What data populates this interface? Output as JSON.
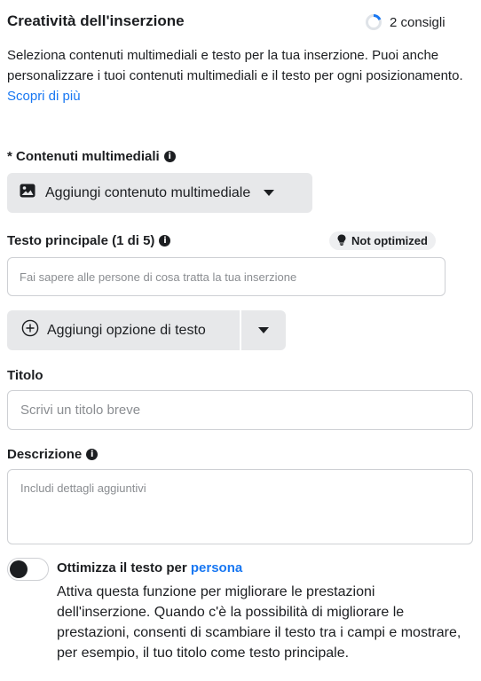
{
  "header": {
    "title": "Creatività dell'inserzione",
    "tips_label": "2 consigli"
  },
  "intro": {
    "text": "Seleziona contenuti multimediali e testo per la tua inserzione. Puoi anche personalizzare i tuoi contenuti multimediali e il testo per ogni posizionamento.",
    "link": "Scopri di più"
  },
  "media": {
    "label": "* Contenuti multimediali",
    "button_label": "Aggiungi contenuto multimediale"
  },
  "primary_text": {
    "label": "Testo principale (1 di 5)",
    "badge": "Not optimized",
    "placeholder": "Fai sapere alle persone di cosa tratta la tua inserzione",
    "add_option_label": "Aggiungi opzione di testo"
  },
  "title_field": {
    "label": "Titolo",
    "placeholder": "Scrivi un titolo breve"
  },
  "description_field": {
    "label": "Descrizione",
    "placeholder": "Includi dettagli aggiuntivi"
  },
  "optimize": {
    "title_prefix": "Ottimizza il testo per",
    "title_link": "persona",
    "enabled": false,
    "body": "Attiva questa funzione per migliorare le prestazioni dell'inserzione. Quando c'è la possibilità di migliorare le prestazioni, consenti di scambiare il testo tra i campi e mostrare, per esempio, il tuo titolo come testo principale."
  },
  "colors": {
    "accent": "#1877f2",
    "button_bg": "#e7e8ea",
    "text": "#1c1e21",
    "placeholder": "#8a8d91"
  },
  "icons": [
    "progress-ring-icon",
    "info-icon",
    "image-icon",
    "caret-down-icon",
    "lightbulb-icon",
    "plus-circle-icon"
  ]
}
